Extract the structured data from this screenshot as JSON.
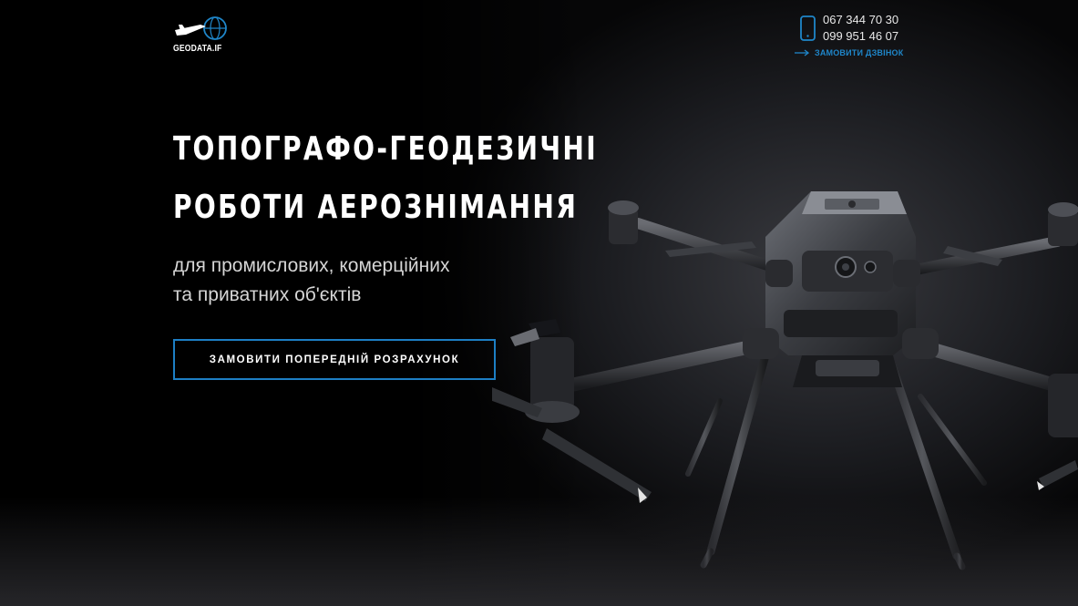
{
  "header": {
    "logo_text": "GEODATA.IF",
    "phones": [
      "067 344 70 30",
      "099 951 46 07"
    ],
    "callback_label": "ЗАМОВИТИ ДЗВІНОК"
  },
  "hero": {
    "title_lines": [
      "ТОПОГРАФО-ГЕОДЕЗИЧНІ",
      "РОБОТИ АЕРОЗНІМАННЯ"
    ],
    "subtitle_lines": [
      "для промислових, комерційних",
      "та приватних об'єктів"
    ],
    "cta_label": "ЗАМОВИТИ ПОПЕРЕДНІЙ РОЗРАХУНОК"
  },
  "icons": {
    "logo": "globe-plane-logo",
    "phone": "smartphone-icon",
    "arrow": "arrow-right-icon"
  },
  "colors": {
    "accent": "#1d7fc4",
    "background": "#000000",
    "text": "#ffffff"
  }
}
